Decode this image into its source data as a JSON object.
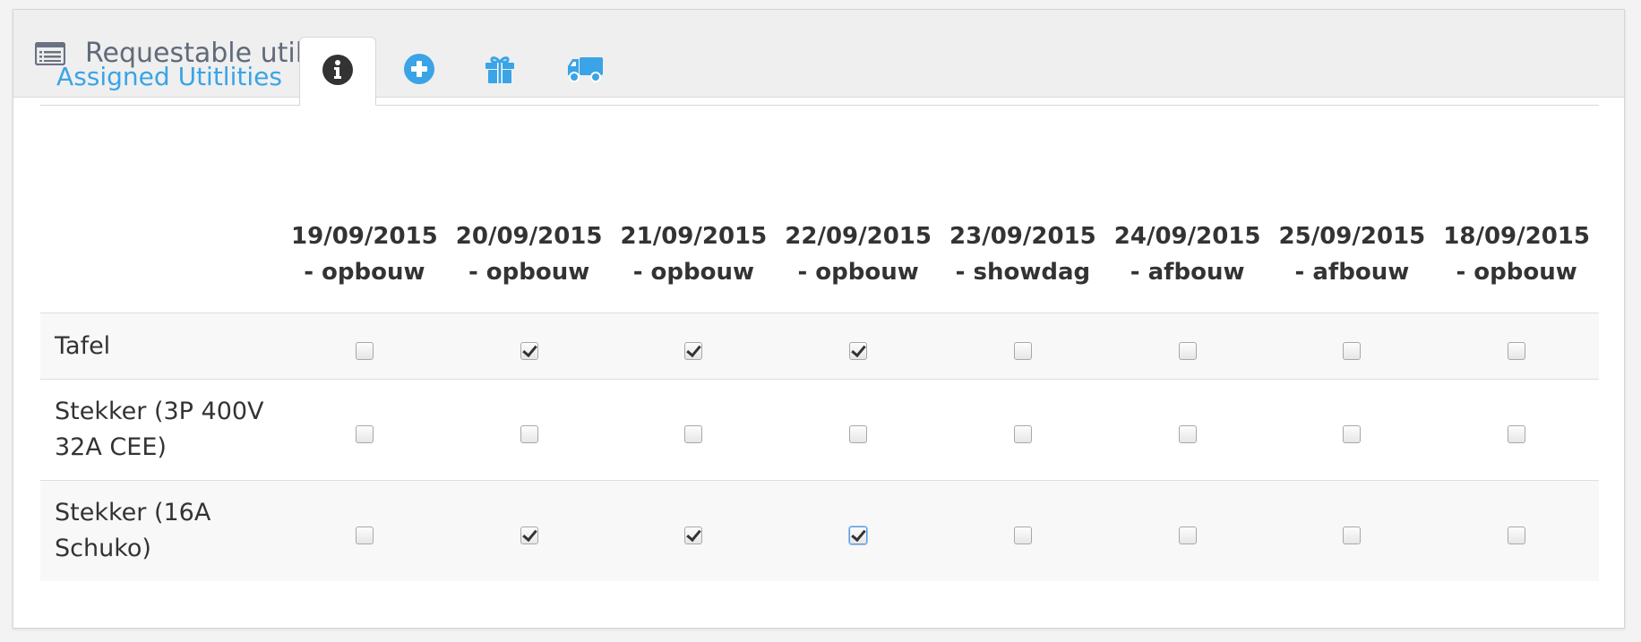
{
  "panel": {
    "title": "Requestable utilities",
    "icon": "list-icon"
  },
  "tabs": [
    {
      "label": "Assigned Utitlities",
      "type": "text"
    },
    {
      "icon": "info-icon",
      "active": true
    },
    {
      "icon": "plus-circle-icon"
    },
    {
      "icon": "gift-icon"
    },
    {
      "icon": "truck-icon"
    }
  ],
  "colors": {
    "link_blue": "#3aa4e6",
    "icon_dark": "#333333"
  },
  "table": {
    "columns": [
      {
        "date": "19/09/2015",
        "phase": "- opbouw"
      },
      {
        "date": "20/09/2015",
        "phase": "- opbouw"
      },
      {
        "date": "21/09/2015",
        "phase": "- opbouw"
      },
      {
        "date": "22/09/2015",
        "phase": "- opbouw"
      },
      {
        "date": "23/09/2015",
        "phase": "- showdag"
      },
      {
        "date": "24/09/2015",
        "phase": "- afbouw"
      },
      {
        "date": "25/09/2015",
        "phase": "- afbouw"
      },
      {
        "date": "18/09/2015",
        "phase": "- opbouw"
      }
    ],
    "rows": [
      {
        "label_line1": "Tafel",
        "label_line2": "",
        "checked": [
          false,
          true,
          true,
          true,
          false,
          false,
          false,
          false
        ]
      },
      {
        "label_line1": "Stekker (3P 400V",
        "label_line2": "32A CEE)",
        "checked": [
          false,
          false,
          false,
          false,
          false,
          false,
          false,
          false
        ]
      },
      {
        "label_line1": "Stekker (16A",
        "label_line2": "Schuko)",
        "checked": [
          false,
          true,
          true,
          true,
          false,
          false,
          false,
          false
        ]
      }
    ]
  }
}
